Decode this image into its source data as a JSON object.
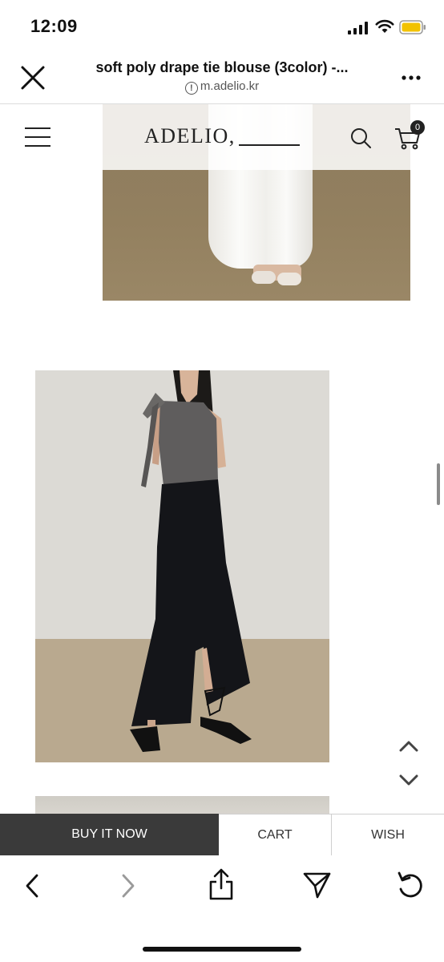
{
  "status_bar": {
    "time": "12:09"
  },
  "browser": {
    "page_title": "soft poly drape tie blouse (3color) -...",
    "url": "m.adelio.kr"
  },
  "site": {
    "logo": "ADELIO,",
    "cart_count": "0"
  },
  "actions": {
    "buy_now": "BUY IT NOW",
    "cart": "CART",
    "wish": "WISH"
  },
  "colors": {
    "buy_button_bg": "#3a3a3a",
    "page_bg": "#ffffff",
    "text": "#111111"
  },
  "icons": [
    "close-icon",
    "info-icon",
    "more-icon",
    "menu-icon",
    "search-icon",
    "cart-icon",
    "chevron-up-icon",
    "chevron-down-icon",
    "back-icon",
    "forward-icon",
    "share-icon",
    "send-icon",
    "reload-icon",
    "signal-icon",
    "wifi-icon",
    "battery-icon"
  ]
}
